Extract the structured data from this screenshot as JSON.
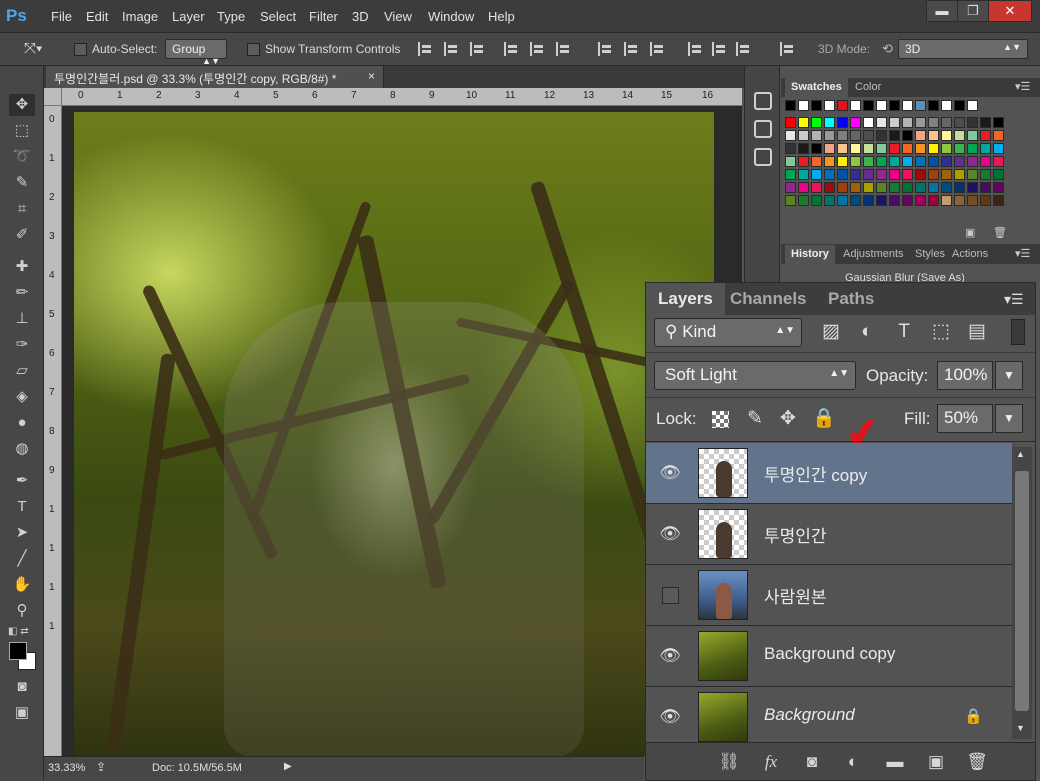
{
  "app": {
    "logo": "Ps"
  },
  "menu": [
    "File",
    "Edit",
    "Image",
    "Layer",
    "Type",
    "Select",
    "Filter",
    "3D",
    "View",
    "Window",
    "Help"
  ],
  "window_controls": {
    "minimize": "▬",
    "maximize": "❐",
    "close": "✕"
  },
  "options": {
    "auto_select_label": "Auto-Select:",
    "auto_select_value": "Group",
    "show_transform_label": "Show Transform Controls",
    "mode_label": "3D Mode:",
    "mode_value": "3D"
  },
  "document": {
    "tab_title": "투명인간블러.psd @ 33.3% (투명인간 copy, RGB/8#) *",
    "close": "×"
  },
  "ruler": {
    "top": [
      "0",
      "1",
      "2",
      "3",
      "4",
      "5",
      "6",
      "7",
      "8",
      "9",
      "10",
      "11",
      "12",
      "13",
      "14",
      "15",
      "16"
    ],
    "left": [
      "0",
      "1",
      "2",
      "3",
      "4",
      "5",
      "6",
      "7",
      "8",
      "9",
      "1",
      "1",
      "1",
      "1"
    ]
  },
  "status": {
    "zoom": "33.33%",
    "doc": "Doc: 10.5M/56.5M"
  },
  "swatches": {
    "tab_active": "Swatches",
    "tab_other": "Color",
    "colors_row1": [
      "#000000",
      "#ffffff",
      "#000000",
      "#ffffff",
      "#e0141e",
      "#ffffff",
      "#000000",
      "#ffffff",
      "#000000",
      "#ffffff",
      "#5d8fb6",
      "#000000",
      "#ffffff",
      "#000000",
      "#ffffff"
    ],
    "palette": [
      "#ff0000",
      "#ffff00",
      "#00ff00",
      "#00ffff",
      "#0000ff",
      "#ff00ff",
      "#ffffff",
      "#e6e6e6",
      "#cccccc",
      "#b3b3b3",
      "#999999",
      "#808080",
      "#666666",
      "#4d4d4d",
      "#333333",
      "#1a1a1a",
      "#000000",
      "#f4a283",
      "#f9c38c",
      "#fff799",
      "#c4df9b",
      "#82ca9c",
      "#ed1c24",
      "#f26522",
      "#f7941d",
      "#fff200",
      "#8dc63f",
      "#39b54a",
      "#00a651",
      "#00a99d",
      "#00aeef",
      "#0072bc",
      "#0054a6",
      "#2e3192",
      "#662d91",
      "#92278f",
      "#ec008c",
      "#ed145b",
      "#9e0b0f",
      "#a0410d",
      "#a36209",
      "#aba000",
      "#598527",
      "#1a7b30",
      "#007236",
      "#00746b",
      "#0076a3",
      "#004b80",
      "#003471",
      "#1b1464",
      "#440e62",
      "#630460",
      "#9e005d",
      "#9e0039",
      "#c69c6d",
      "#8c6239",
      "#754c24",
      "#603913",
      "#3c2415"
    ]
  },
  "history": {
    "tabs": [
      "History",
      "Adjustments",
      "Styles",
      "Actions"
    ],
    "item": "Gaussian Blur (Save As)"
  },
  "layers": {
    "tabs": [
      "Layers",
      "Channels",
      "Paths"
    ],
    "kind_label": "Kind",
    "blend_mode": "Soft Light",
    "opacity_label": "Opacity:",
    "opacity_value": "100%",
    "lock_label": "Lock:",
    "fill_label": "Fill:",
    "fill_value": "50%",
    "items": [
      {
        "name": "투명인간 copy",
        "visible": true,
        "selected": true,
        "thumb": "checker"
      },
      {
        "name": "투명인간",
        "visible": true,
        "selected": false,
        "thumb": "checker"
      },
      {
        "name": "사람원본",
        "visible": false,
        "selected": false,
        "thumb": "photo"
      },
      {
        "name": "Background copy",
        "visible": true,
        "selected": false,
        "thumb": "forest"
      },
      {
        "name": "Background",
        "visible": true,
        "selected": false,
        "thumb": "forest",
        "locked": true
      }
    ],
    "footer_icons": [
      "link-icon",
      "fx-icon",
      "mask-icon",
      "adjustment-icon",
      "folder-icon",
      "new-layer-icon",
      "trash-icon"
    ]
  }
}
